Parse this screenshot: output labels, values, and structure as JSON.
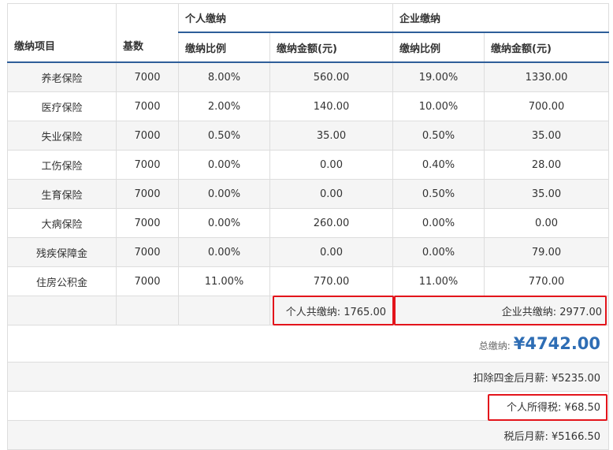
{
  "headers": {
    "item": "缴纳项目",
    "base": "基数",
    "personal_group": "个人缴纳",
    "company_group": "企业缴纳",
    "rate": "缴纳比例",
    "amount": "缴纳金额(元)"
  },
  "rows": [
    {
      "name": "养老保险",
      "base": "7000",
      "p_rate": "8.00%",
      "p_amount": "560.00",
      "c_rate": "19.00%",
      "c_amount": "1330.00"
    },
    {
      "name": "医疗保险",
      "base": "7000",
      "p_rate": "2.00%",
      "p_amount": "140.00",
      "c_rate": "10.00%",
      "c_amount": "700.00"
    },
    {
      "name": "失业保险",
      "base": "7000",
      "p_rate": "0.50%",
      "p_amount": "35.00",
      "c_rate": "0.50%",
      "c_amount": "35.00"
    },
    {
      "name": "工伤保险",
      "base": "7000",
      "p_rate": "0.00%",
      "p_amount": "0.00",
      "c_rate": "0.40%",
      "c_amount": "28.00"
    },
    {
      "name": "生育保险",
      "base": "7000",
      "p_rate": "0.00%",
      "p_amount": "0.00",
      "c_rate": "0.50%",
      "c_amount": "35.00"
    },
    {
      "name": "大病保险",
      "base": "7000",
      "p_rate": "0.00%",
      "p_amount": "260.00",
      "c_rate": "0.00%",
      "c_amount": "0.00"
    },
    {
      "name": "残疾保障金",
      "base": "7000",
      "p_rate": "0.00%",
      "p_amount": "0.00",
      "c_rate": "0.00%",
      "c_amount": "79.00"
    },
    {
      "name": "住房公积金",
      "base": "7000",
      "p_rate": "11.00%",
      "p_amount": "770.00",
      "c_rate": "11.00%",
      "c_amount": "770.00"
    }
  ],
  "summary": {
    "personal_total": "个人共缴纳: 1765.00",
    "company_total": "企业共缴纳: 2977.00",
    "grand_total_label": "总缴纳:",
    "grand_total_value": "¥4742.00",
    "after_deduction": "扣除四金后月薪: ¥5235.00",
    "income_tax": "个人所得税: ¥68.50",
    "after_tax": "税后月薪: ¥5166.50"
  },
  "colors": {
    "accent": "#2e5e99",
    "highlight_border": "#e3141b",
    "total_value": "#2e6db4"
  }
}
